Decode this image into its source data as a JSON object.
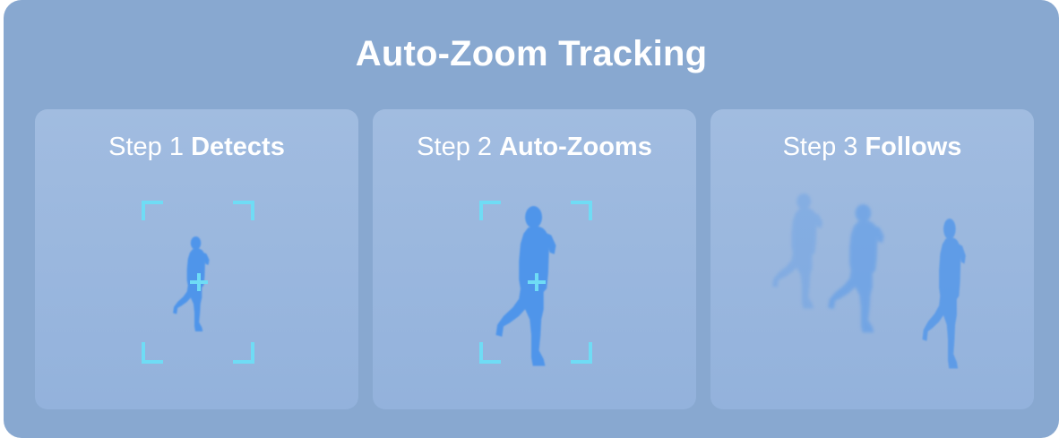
{
  "title": "Auto-Zoom Tracking",
  "steps": [
    {
      "prefix": "Step 1",
      "action": "Detects"
    },
    {
      "prefix": "Step 2",
      "action": "Auto-Zooms"
    },
    {
      "prefix": "Step 3",
      "action": "Follows"
    }
  ],
  "colors": {
    "background": "#88a8d0",
    "card": "#9bb8de",
    "bracket": "#6fdcf5",
    "figure": "#4f95ea",
    "text": "#ffffff"
  },
  "icons": [
    "focus-bracket-icon",
    "crosshair-icon",
    "walking-person-icon"
  ]
}
